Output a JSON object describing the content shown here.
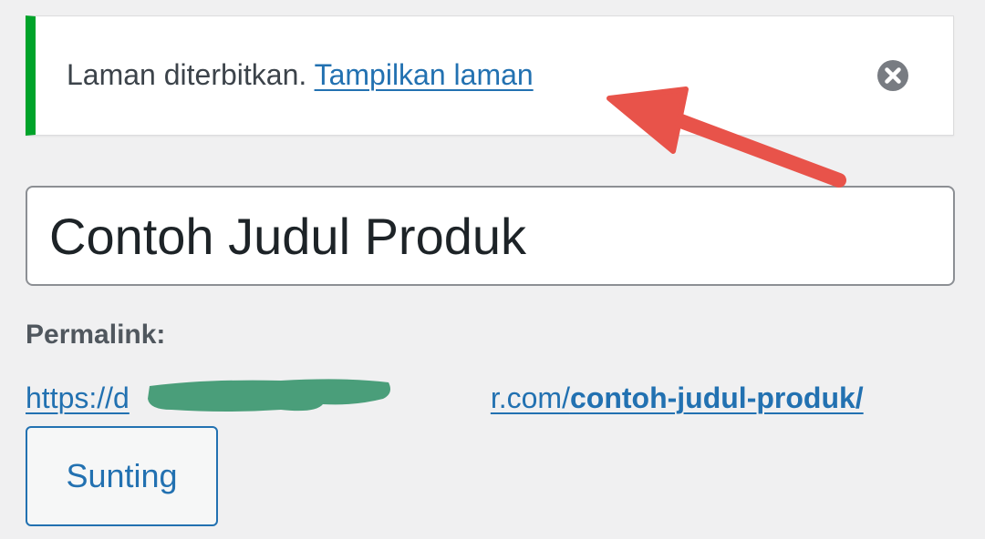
{
  "notice": {
    "message": "Laman diterbitkan.",
    "link_label": "Tampilkan laman",
    "dismiss_icon": "close-circle-icon"
  },
  "title_input": {
    "value": "Contoh Judul Produk"
  },
  "permalink": {
    "label": "Permalink:",
    "url_prefix": "https://d",
    "url_mid": "r.com/",
    "url_slug": "contoh-judul-produk/"
  },
  "edit_button": {
    "label": "Sunting"
  },
  "colors": {
    "notice_border_success": "#00a32a",
    "link": "#2271b1",
    "annotation_arrow": "#e8534a",
    "redaction": "#4a9e7a"
  }
}
